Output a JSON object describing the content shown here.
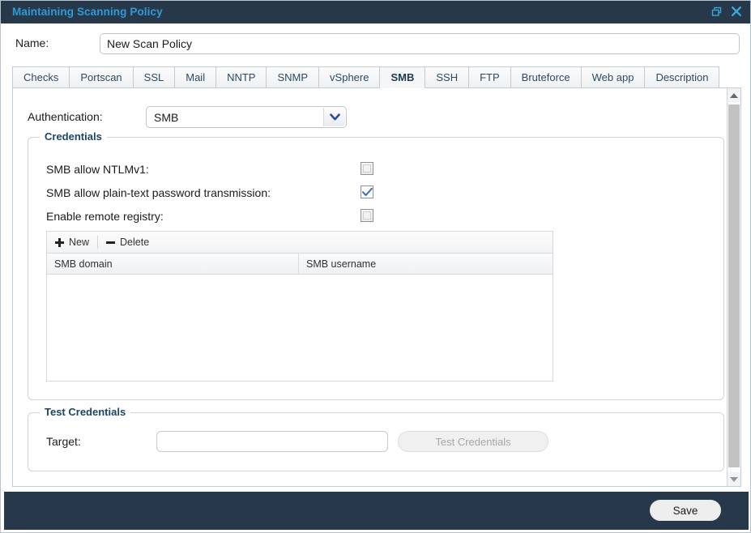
{
  "window": {
    "title": "Maintaining Scanning Policy",
    "title_color": "#2e9bd6",
    "titlebar_color": "#27384b",
    "buttons": [
      {
        "name": "restore-button",
        "icon": "restore-icon",
        "label": "Restore"
      },
      {
        "name": "close-button",
        "icon": "close-icon",
        "label": "Close"
      }
    ]
  },
  "name_field": {
    "label": "Name:",
    "value": "New Scan Policy",
    "placeholder": ""
  },
  "tabs": [
    {
      "label": "Checks",
      "active": false
    },
    {
      "label": "Portscan",
      "active": false
    },
    {
      "label": "SSL",
      "active": false
    },
    {
      "label": "Mail",
      "active": false
    },
    {
      "label": "NNTP",
      "active": false
    },
    {
      "label": "SNMP",
      "active": false
    },
    {
      "label": "vSphere",
      "active": false
    },
    {
      "label": "SMB",
      "active": true
    },
    {
      "label": "SSH",
      "active": false
    },
    {
      "label": "FTP",
      "active": false
    },
    {
      "label": "Bruteforce",
      "active": false
    },
    {
      "label": "Web app",
      "active": false
    },
    {
      "label": "Description",
      "active": false
    }
  ],
  "authentication": {
    "label": "Authentication:",
    "value": "SMB",
    "options": [
      "SMB"
    ]
  },
  "credentials": {
    "legend": "Credentials",
    "checkboxes": [
      {
        "label": "SMB allow NTLMv1:",
        "checked": false
      },
      {
        "label": "SMB allow plain-text password transmission:",
        "checked": true
      },
      {
        "label": "Enable remote registry:",
        "checked": false
      }
    ],
    "toolbar": {
      "new_label": "New",
      "delete_label": "Delete"
    },
    "grid": {
      "columns": [
        "SMB domain",
        "SMB username"
      ],
      "rows": []
    }
  },
  "test_credentials": {
    "legend": "Test Credentials",
    "target_label": "Target:",
    "target_value": "",
    "target_placeholder": "",
    "button_label": "Test Credentials",
    "button_enabled": false
  },
  "footer": {
    "save_label": "Save"
  },
  "scrollbar": {
    "orientation": "vertical",
    "position_percent": 0
  }
}
